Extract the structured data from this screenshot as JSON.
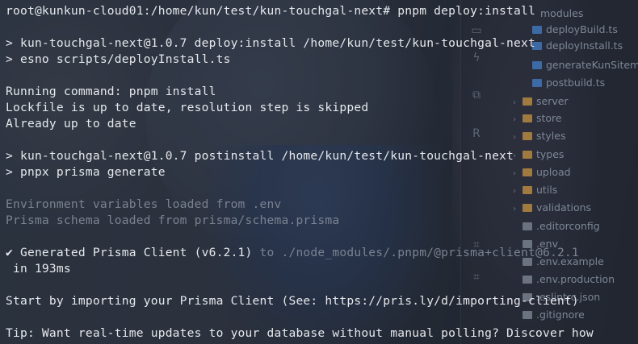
{
  "terminal": {
    "lines": [
      {
        "text": "root@kunkun-cloud01:/home/kun/test/kun-touchgal-next# pnpm deploy:install"
      },
      {
        "text": ""
      },
      {
        "text": "> kun-touchgal-next@1.0.7 deploy:install /home/kun/test/kun-touchgal-next"
      },
      {
        "text": "> esno scripts/deployInstall.ts"
      },
      {
        "text": ""
      },
      {
        "text": "Running command: pnpm install"
      },
      {
        "text": "Lockfile is up to date, resolution step is skipped"
      },
      {
        "text": "Already up to date"
      },
      {
        "text": ""
      },
      {
        "text": "> kun-touchgal-next@1.0.7 postinstall /home/kun/test/kun-touchgal-next"
      },
      {
        "text": "> pnpx prisma generate"
      },
      {
        "text": ""
      },
      {
        "text": "Environment variables loaded from .env"
      },
      {
        "text": "Prisma schema loaded from prisma/schema.prisma"
      },
      {
        "text": ""
      },
      {
        "text": "✔ Generated Prisma Client (v6.2.1)",
        "dim_suffix": " to ./node_modules/.pnpm/@prisma+client@6.2.1"
      },
      {
        "text": " in 193ms"
      },
      {
        "text": ""
      },
      {
        "text": "Start by importing your Prisma Client (See: https://pris.ly/d/importing-client)"
      },
      {
        "text": ""
      },
      {
        "text": "Tip: Want real-time updates to your database without manual polling? Discover how"
      }
    ]
  },
  "ide_tree": {
    "items": [
      {
        "label": "modules",
        "kind": "folder"
      },
      {
        "label": "deployBuild.ts",
        "kind": "file"
      },
      {
        "label": "deployInstall.ts",
        "kind": "file"
      },
      {
        "label": "generateKunSitemap.ts",
        "kind": "file"
      },
      {
        "label": "postbuild.ts",
        "kind": "file"
      },
      {
        "label": "server",
        "kind": "folder"
      },
      {
        "label": "store",
        "kind": "folder"
      },
      {
        "label": "styles",
        "kind": "folder"
      },
      {
        "label": "types",
        "kind": "folder"
      },
      {
        "label": "upload",
        "kind": "folder"
      },
      {
        "label": "utils",
        "kind": "folder"
      },
      {
        "label": "validations",
        "kind": "folder"
      },
      {
        "label": ".editorconfig",
        "kind": "config"
      },
      {
        "label": ".env",
        "kind": "config"
      },
      {
        "label": ".env.example",
        "kind": "config"
      },
      {
        "label": ".env.production",
        "kind": "config"
      },
      {
        "label": ".eslintrc.json",
        "kind": "config"
      },
      {
        "label": ".gitignore",
        "kind": "config"
      }
    ]
  },
  "gutter_icons": [
    "folder-icon",
    "bolt-icon",
    "structure-icon",
    "r-icon",
    "commit-icon",
    "grid-icon"
  ]
}
